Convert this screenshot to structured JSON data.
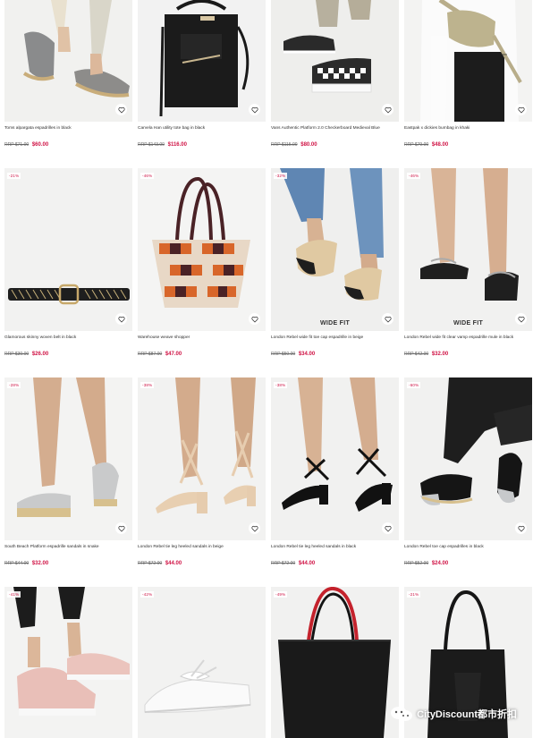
{
  "products": [
    {
      "title": "Toms alpargata espadrilles in black",
      "rrp": "RRP $71.00",
      "price": "$60.00",
      "badge": "",
      "wide_fit": "",
      "image": "espadrille-shoes-photo"
    },
    {
      "title": "Carvela Han utility tote bag in black",
      "rrp": "RRP $143.00",
      "price": "$116.00",
      "badge": "",
      "wide_fit": "",
      "image": "black-tote-bag-photo"
    },
    {
      "title": "Vans Authentic Platform 2.0 Checkerboard Medieval Blue",
      "rrp": "RRP $115.00",
      "price": "$80.00",
      "badge": "",
      "wide_fit": "",
      "image": "checkerboard-sneakers-photo"
    },
    {
      "title": "Eastpak x dickies bumbag in khaki",
      "rrp": "RRP $79.00",
      "price": "$48.00",
      "badge": "",
      "wide_fit": "",
      "image": "khaki-bumbag-photo"
    },
    {
      "title": "Glamorous skinny woven belt in black",
      "rrp": "RRP $30.00",
      "price": "$26.00",
      "badge": "-21%",
      "wide_fit": "",
      "image": "woven-belt-photo"
    },
    {
      "title": "Warehouse weave shopper",
      "rrp": "RRP $87.00",
      "price": "$47.00",
      "badge": "-46%",
      "wide_fit": "",
      "image": "weave-shopper-photo"
    },
    {
      "title": "London Rebel wide fit toe cap espadrille in beige",
      "rrp": "RRP $50.00",
      "price": "$34.00",
      "badge": "-32%",
      "wide_fit": "WIDE FIT",
      "image": "toe-cap-espadrille-photo"
    },
    {
      "title": "London Rebel wide fit clear vamp espadrille mule in black",
      "rrp": "RRP $42.00",
      "price": "$32.00",
      "badge": "-46%",
      "wide_fit": "WIDE FIT",
      "image": "clear-vamp-mule-photo"
    },
    {
      "title": "South Beach Platform espadrille sandals in snake",
      "rrp": "RRP $44.00",
      "price": "$32.00",
      "badge": "-28%",
      "wide_fit": "",
      "image": "platform-sandals-photo"
    },
    {
      "title": "London Rebel tie leg heeled sandals in beige",
      "rrp": "RRP $72.00",
      "price": "$44.00",
      "badge": "-38%",
      "wide_fit": "",
      "image": "beige-heeled-sandals-photo"
    },
    {
      "title": "London Rebel tie leg heeled sandals in black",
      "rrp": "RRP $72.00",
      "price": "$44.00",
      "badge": "-38%",
      "wide_fit": "",
      "image": "black-heeled-sandals-photo"
    },
    {
      "title": "London Rebel toe cap espadrilles in black",
      "rrp": "RRP $52.00",
      "price": "$24.00",
      "badge": "-60%",
      "wide_fit": "",
      "image": "black-espadrilles-photo"
    },
    {
      "title": "",
      "rrp": "",
      "price": "",
      "badge": "-41%",
      "wide_fit": "",
      "image": "pink-sneakers-photo"
    },
    {
      "title": "",
      "rrp": "",
      "price": "",
      "badge": "-42%",
      "wide_fit": "",
      "image": "white-satin-sneakers-photo"
    },
    {
      "title": "",
      "rrp": "",
      "price": "",
      "badge": "-49%",
      "wide_fit": "",
      "image": "black-red-tote-photo"
    },
    {
      "title": "",
      "rrp": "",
      "price": "",
      "badge": "-21%",
      "wide_fit": "",
      "image": "black-leather-tote-photo"
    }
  ],
  "watermark": {
    "text": "CityDiscount都市折扣"
  },
  "colors": {
    "sale": "#d01345",
    "text": "#2d2d2d",
    "tile_bg": "#f0f0ef"
  },
  "icons": {
    "save": "heart-icon",
    "watermark_logo": "wechat-icon"
  }
}
